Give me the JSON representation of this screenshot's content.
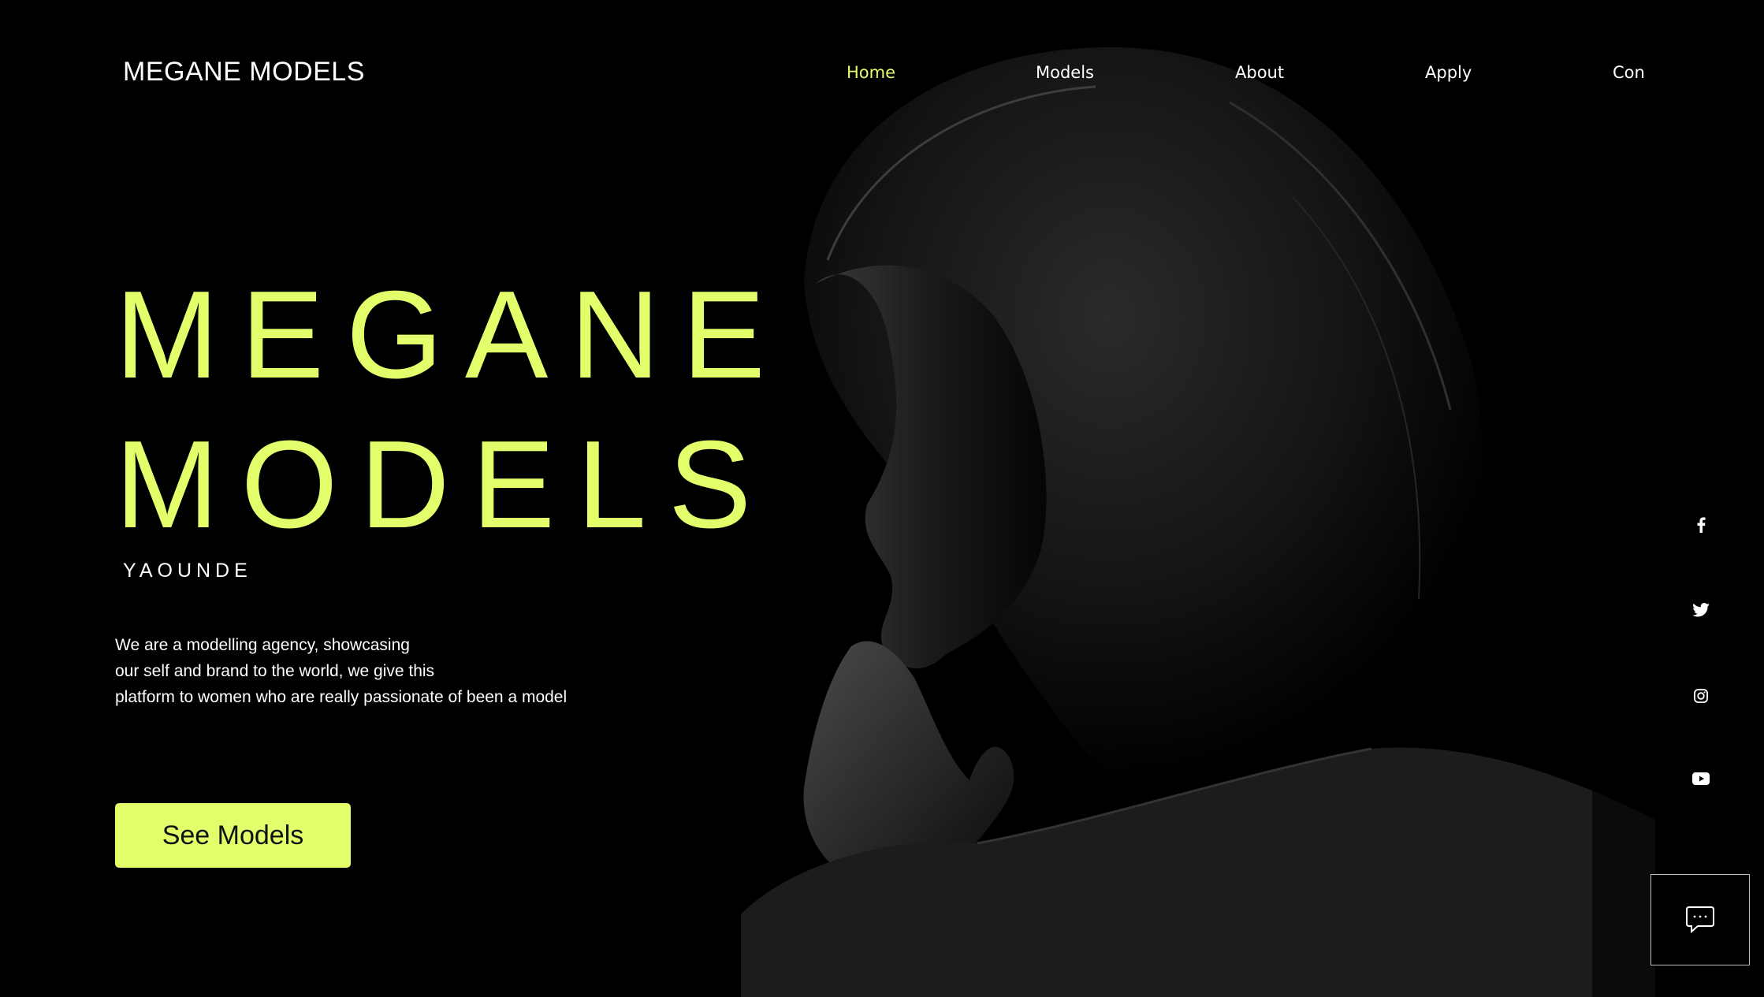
{
  "header": {
    "brand": "MEGANE MODELS",
    "nav": [
      {
        "label": "Home",
        "active": true
      },
      {
        "label": "Models",
        "active": false
      },
      {
        "label": "About",
        "active": false
      },
      {
        "label": "Apply",
        "active": false
      },
      {
        "label": "Con",
        "active": false
      }
    ]
  },
  "hero": {
    "title_line1": "MEGANE",
    "title_line2": "MODELS",
    "subtitle": "YAOUNDE",
    "description": [
      "We are a modelling agency, showcasing",
      "our self and brand to the world, we give this",
      "platform to women who are really passionate of been a model"
    ],
    "cta_label": "See Models"
  },
  "social": {
    "icons": [
      "facebook-icon",
      "twitter-icon",
      "instagram-icon",
      "youtube-icon"
    ]
  },
  "chat": {
    "icon": "chat-bubble-icon"
  },
  "colors": {
    "accent": "#e2ff6b",
    "background": "#000000",
    "text": "#ffffff"
  }
}
